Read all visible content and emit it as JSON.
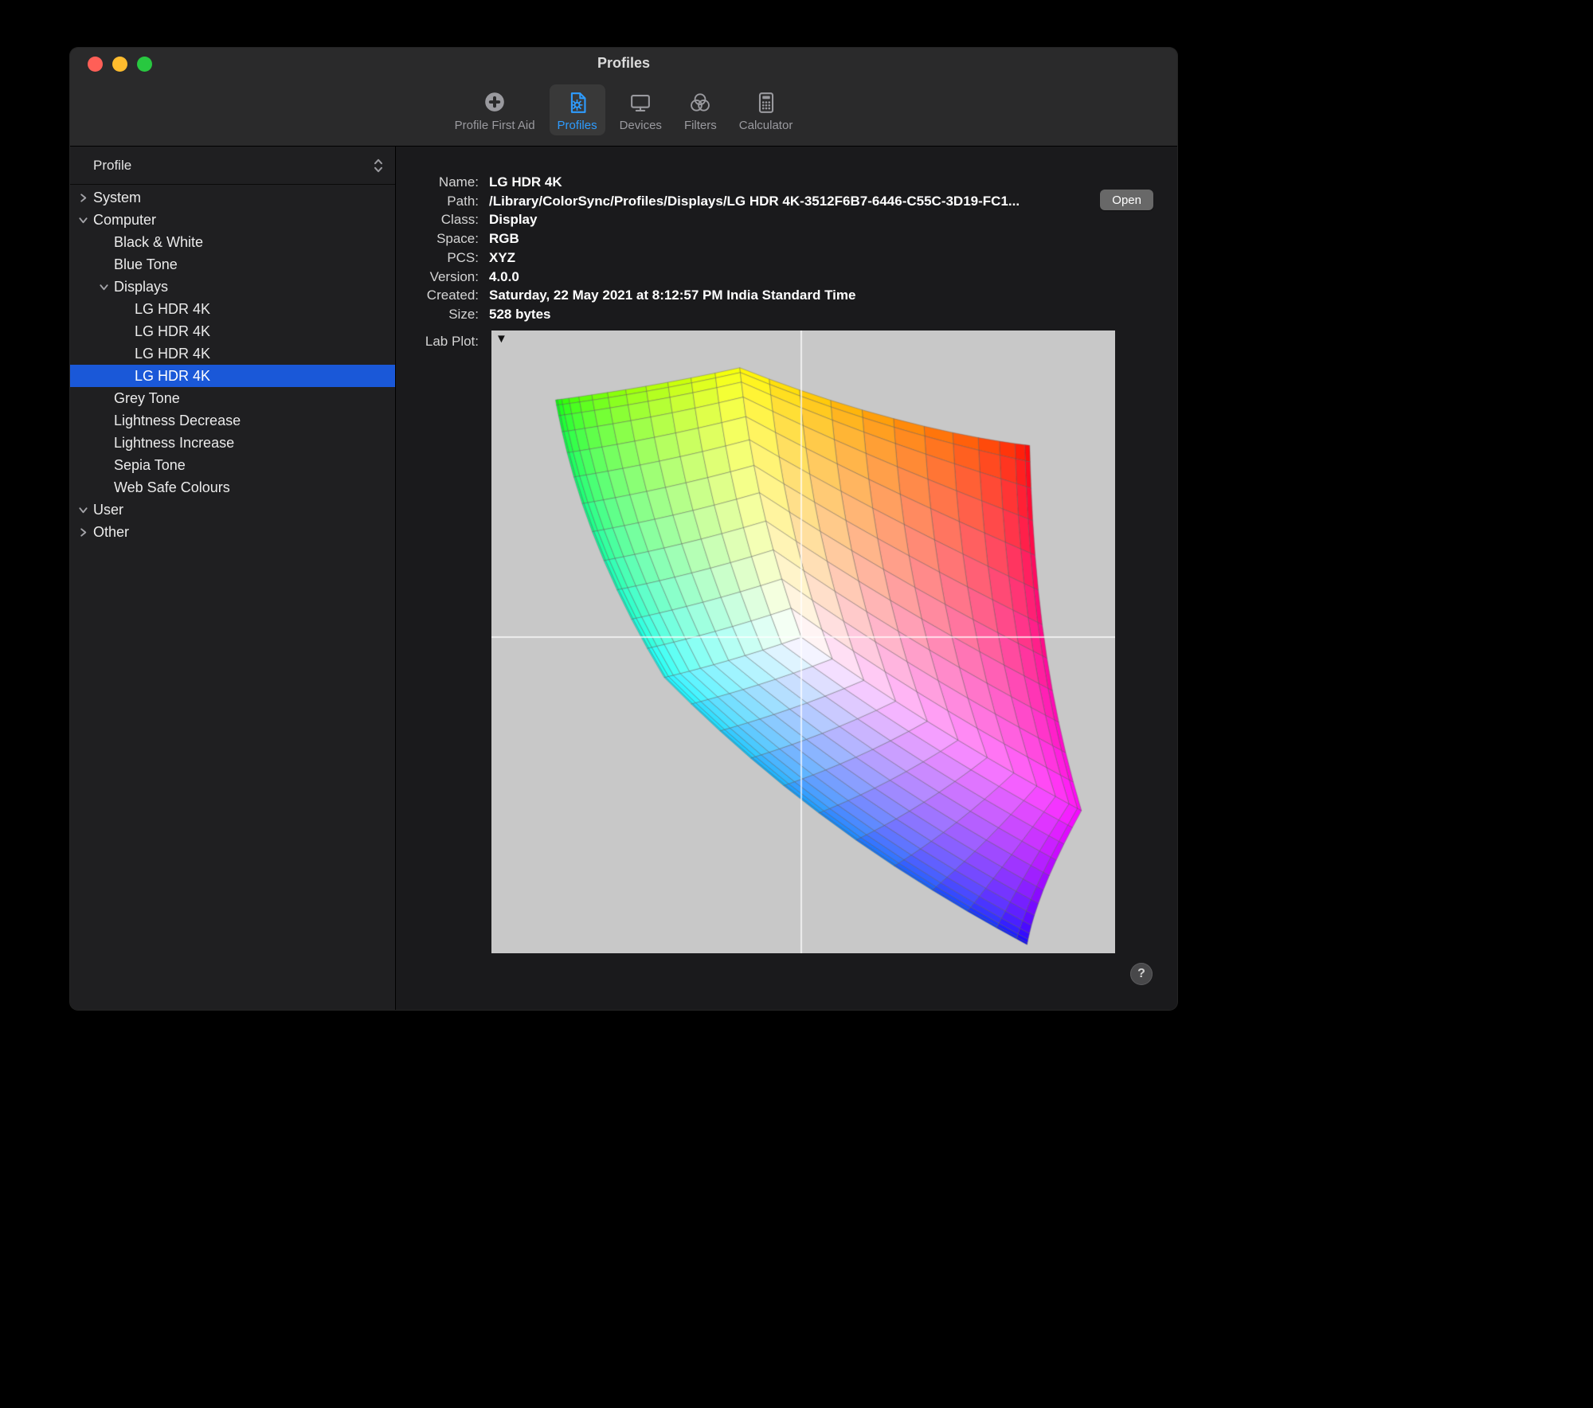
{
  "colors": {
    "accent_blue": "#2e9cff",
    "selection_blue": "#1a58d8",
    "plot_background": "#c8c8c8",
    "close": "#ff5f57",
    "minimize": "#febc2e",
    "zoom": "#28c840"
  },
  "window": {
    "title": "Profiles",
    "traffic_lights": [
      "close",
      "minimize",
      "zoom"
    ],
    "toolbar": [
      {
        "label": "Profile First Aid",
        "icon": "profile-first-aid",
        "selected": false
      },
      {
        "label": "Profiles",
        "icon": "profiles-document-gear",
        "selected": true
      },
      {
        "label": "Devices",
        "icon": "display-monitor",
        "selected": false
      },
      {
        "label": "Filters",
        "icon": "venn-circles",
        "selected": false
      },
      {
        "label": "Calculator",
        "icon": "calculator",
        "selected": false
      }
    ]
  },
  "sidebar": {
    "header": "Profile",
    "header_stepper_icon": "up-down-chevrons",
    "tree": [
      {
        "label": "System",
        "level": 0,
        "chevron": "right",
        "selected": false
      },
      {
        "label": "Computer",
        "level": 0,
        "chevron": "down",
        "selected": false
      },
      {
        "label": "Black & White",
        "level": 1,
        "chevron": null,
        "selected": false
      },
      {
        "label": "Blue Tone",
        "level": 1,
        "chevron": null,
        "selected": false
      },
      {
        "label": "Displays",
        "level": 1,
        "chevron": "down",
        "selected": false
      },
      {
        "label": "LG HDR 4K",
        "level": 2,
        "chevron": null,
        "selected": false
      },
      {
        "label": "LG HDR 4K",
        "level": 2,
        "chevron": null,
        "selected": false
      },
      {
        "label": "LG HDR 4K",
        "level": 2,
        "chevron": null,
        "selected": false
      },
      {
        "label": "LG HDR 4K",
        "level": 2,
        "chevron": null,
        "selected": true
      },
      {
        "label": "Grey Tone",
        "level": 1,
        "chevron": null,
        "selected": false
      },
      {
        "label": "Lightness Decrease",
        "level": 1,
        "chevron": null,
        "selected": false
      },
      {
        "label": "Lightness Increase",
        "level": 1,
        "chevron": null,
        "selected": false
      },
      {
        "label": "Sepia Tone",
        "level": 1,
        "chevron": null,
        "selected": false
      },
      {
        "label": "Web Safe Colours",
        "level": 1,
        "chevron": null,
        "selected": false
      },
      {
        "label": "User",
        "level": 0,
        "chevron": "down",
        "selected": false
      },
      {
        "label": "Other",
        "level": 0,
        "chevron": "right",
        "selected": false
      }
    ]
  },
  "details": {
    "rows": [
      {
        "label": "Name:",
        "value": "LG HDR 4K"
      },
      {
        "label": "Path:",
        "value": "/Library/ColorSync/Profiles/Displays/LG HDR 4K-3512F6B7-6446-C55C-3D19-FC1..."
      },
      {
        "label": "Class:",
        "value": "Display"
      },
      {
        "label": "Space:",
        "value": "RGB"
      },
      {
        "label": "PCS:",
        "value": "XYZ"
      },
      {
        "label": "Version:",
        "value": "4.0.0"
      },
      {
        "label": "Created:",
        "value": "Saturday, 22 May 2021 at 8:12:57 PM India Standard Time"
      },
      {
        "label": "Size:",
        "value": "528 bytes"
      }
    ],
    "open_button": "Open",
    "plot_label": "Lab Plot:",
    "plot_disclosure": "▼",
    "help_button": "?"
  },
  "lab_plot": {
    "type": "lab-gamut-mesh",
    "background": "#c8c8c8",
    "crosshair_color": "#ffffff",
    "grid_divisions": 12
  }
}
